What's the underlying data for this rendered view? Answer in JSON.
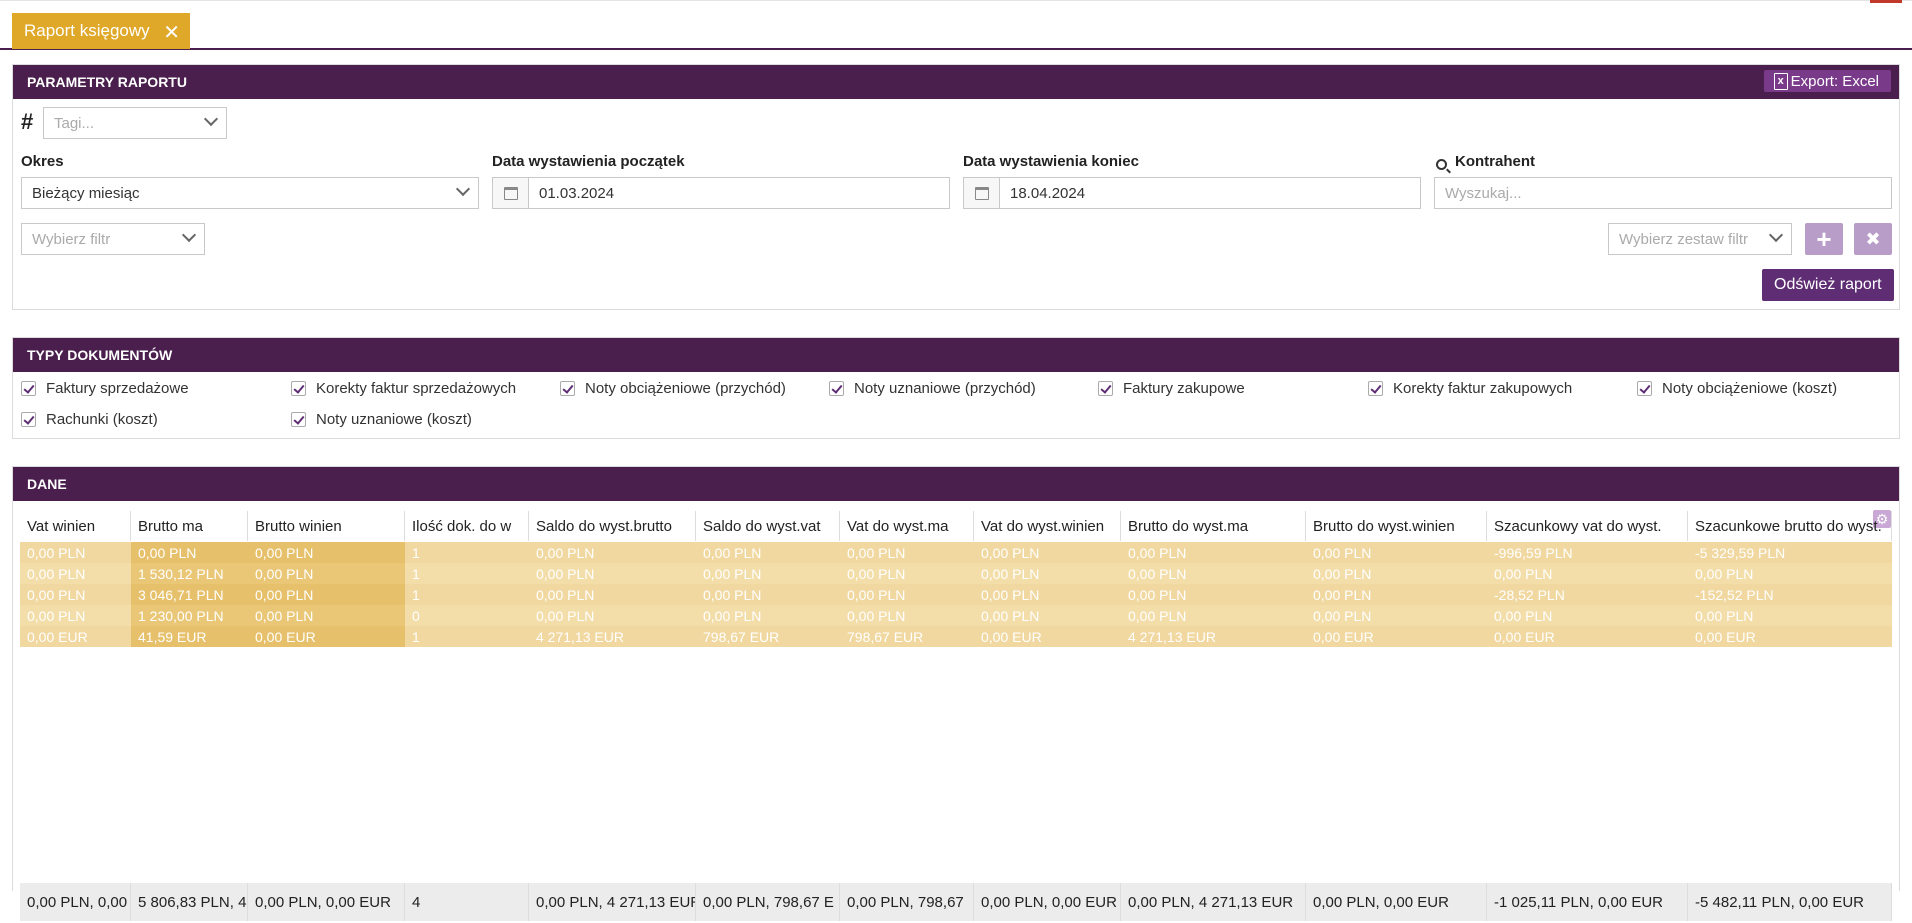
{
  "tab": {
    "label": "Raport księgowy",
    "close": "✕"
  },
  "params": {
    "header": "PARAMETRY RAPORTU",
    "export_label": "Export: Excel",
    "tags_placeholder": "Tagi...",
    "okres_label": "Okres",
    "okres_value": "Bieżący miesiąc",
    "start_label": "Data wystawienia początek",
    "start_value": "01.03.2024",
    "end_label": "Data wystawienia koniec",
    "end_value": "18.04.2024",
    "kontrahent_label": "Kontrahent",
    "kontrahent_placeholder": "Wyszukaj...",
    "filter_placeholder": "Wybierz filtr",
    "filterset_placeholder": "Wybierz zestaw filtr",
    "add_symbol": "+",
    "remove_symbol": "✖",
    "refresh_label": "Odśwież raport"
  },
  "doc_types": {
    "header": "TYPY DOKUMENTÓW",
    "items": [
      "Faktury sprzedażowe",
      "Korekty faktur sprzedażowych",
      "Noty obciążeniowe (przychód)",
      "Noty uznaniowe (przychód)",
      "Faktury zakupowe",
      "Korekty faktur zakupowych",
      "Noty obciążeniowe (koszt)",
      "Rachunki (koszt)",
      "Noty uznaniowe (koszt)"
    ]
  },
  "data": {
    "header": "DANE",
    "columns": [
      "Vat winien",
      "Brutto ma",
      "Brutto winien",
      "Ilość dok. do w",
      "Saldo do wyst.brutto",
      "Saldo do wyst.vat",
      "Vat do wyst.ma",
      "Vat do wyst.winien",
      "Brutto do wyst.ma",
      "Brutto do wyst.winien",
      "Szacunkowy vat do wyst.",
      "Szacunkowe brutto do wyst."
    ],
    "rows": [
      [
        "0,00 PLN",
        "0,00 PLN",
        "0,00 PLN",
        "1",
        "0,00 PLN",
        "0,00 PLN",
        "0,00 PLN",
        "0,00 PLN",
        "0,00 PLN",
        "0,00 PLN",
        "-996,59 PLN",
        "-5 329,59 PLN"
      ],
      [
        "0,00 PLN",
        "1 530,12 PLN",
        "0,00 PLN",
        "1",
        "0,00 PLN",
        "0,00 PLN",
        "0,00 PLN",
        "0,00 PLN",
        "0,00 PLN",
        "0,00 PLN",
        "0,00 PLN",
        "0,00 PLN"
      ],
      [
        "0,00 PLN",
        "3 046,71 PLN",
        "0,00 PLN",
        "1",
        "0,00 PLN",
        "0,00 PLN",
        "0,00 PLN",
        "0,00 PLN",
        "0,00 PLN",
        "0,00 PLN",
        "-28,52 PLN",
        "-152,52 PLN"
      ],
      [
        "0,00 PLN",
        "1 230,00 PLN",
        "0,00 PLN",
        "0",
        "0,00 PLN",
        "0,00 PLN",
        "0,00 PLN",
        "0,00 PLN",
        "0,00 PLN",
        "0,00 PLN",
        "0,00 PLN",
        "0,00 PLN"
      ],
      [
        "0,00 EUR",
        "41,59 EUR",
        "0,00 EUR",
        "1",
        "4 271,13 EUR",
        "798,67 EUR",
        "798,67 EUR",
        "0,00 EUR",
        "4 271,13 EUR",
        "0,00 EUR",
        "0,00 EUR",
        "0,00 EUR"
      ]
    ],
    "totals": [
      "0,00 PLN, 0,00",
      "5 806,83 PLN, 4",
      "0,00 PLN, 0,00 EUR",
      "4",
      "0,00 PLN, 4 271,13 EUR",
      "0,00 PLN, 798,67 E",
      "0,00 PLN, 798,67",
      "0,00 PLN, 0,00 EUR",
      "0,00 PLN, 4 271,13 EUR",
      "0,00 PLN, 0,00 EUR",
      "-1 025,11 PLN, 0,00 EUR",
      "-5 482,11 PLN, 0,00 EUR"
    ]
  },
  "colors": {
    "header_bg": "#4a1f4d",
    "tab_bg": "#e0a828",
    "row_light": "#f0d8a0",
    "row_dark": "#e6c06a",
    "button": "#5e2d73"
  }
}
